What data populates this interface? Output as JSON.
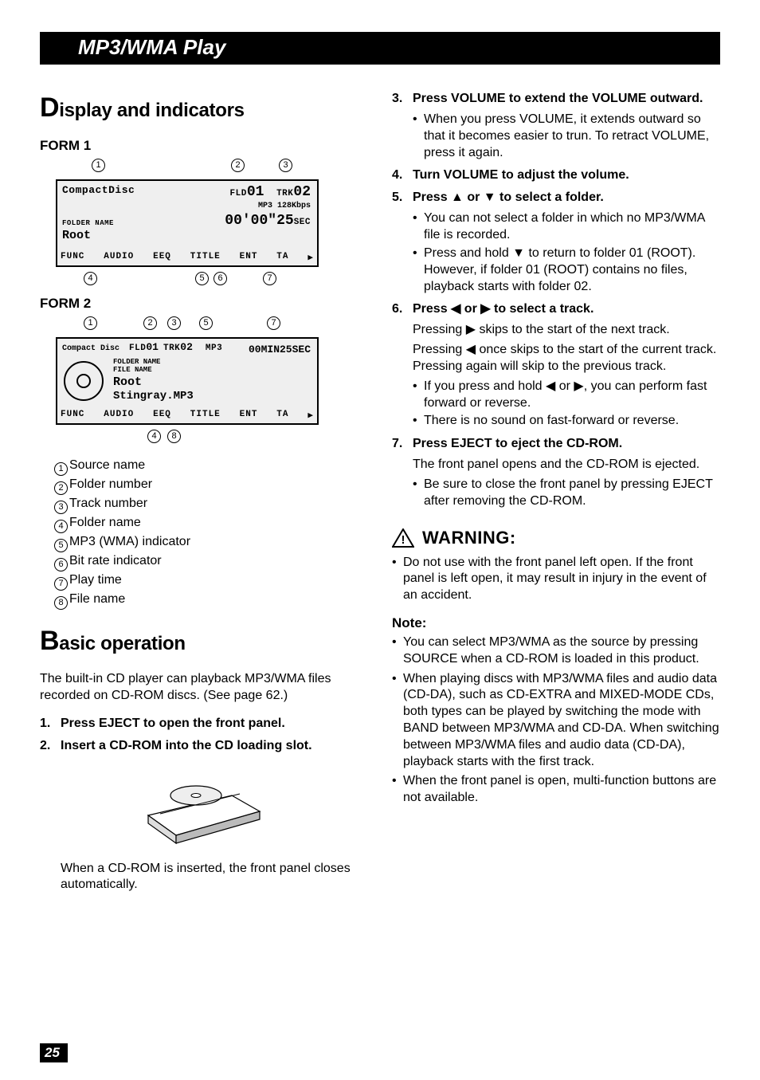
{
  "banner": "MP3/WMA Play",
  "headings": {
    "display": "isplay and indicators",
    "display_cap": "D",
    "basic": "asic operation",
    "basic_cap": "B"
  },
  "forms": {
    "form1": "FORM 1",
    "form2": "FORM 2"
  },
  "display1": {
    "title": "CompactDisc",
    "fld_label": "FLD",
    "fld_val": "01",
    "trk_label": "TRK",
    "trk_val": "02",
    "mp3": "MP3",
    "bitrate": "128Kbps",
    "time": "00'00\"25",
    "sec": "SEC",
    "folder_label": "FOLDER NAME",
    "folder": "Root",
    "bottom": [
      "FUNC",
      "AUDIO",
      "EEQ",
      "TITLE",
      "ENT",
      "TA",
      "▶"
    ]
  },
  "display2": {
    "title": "Compact Disc",
    "fld_label": "FLD",
    "fld_val": "01",
    "trk_label": "TRK",
    "trk_val": "02",
    "mp3": "MP3",
    "time": "00MIN25SEC",
    "folder_label": "FOLDER NAME",
    "file_label": "FILE NAME",
    "folder": "Root",
    "file": "Stingray.MP3",
    "bottom": [
      "FUNC",
      "AUDIO",
      "EEQ",
      "TITLE",
      "ENT",
      "TA",
      "▶"
    ]
  },
  "callouts": {
    "form1_top": [
      "①",
      "②",
      "③"
    ],
    "form1_bottom": [
      "④",
      "⑤",
      "⑥",
      "⑦"
    ],
    "form2_top": [
      "①",
      "②",
      "③",
      "⑤",
      "⑦"
    ],
    "form2_bottom": [
      "④",
      "⑧"
    ]
  },
  "legend": [
    {
      "n": "①",
      "t": "Source name"
    },
    {
      "n": "②",
      "t": "Folder number"
    },
    {
      "n": "③",
      "t": "Track number"
    },
    {
      "n": "④",
      "t": "Folder name"
    },
    {
      "n": "⑤",
      "t": "MP3 (WMA) indicator"
    },
    {
      "n": "⑥",
      "t": "Bit rate indicator"
    },
    {
      "n": "⑦",
      "t": "Play time"
    },
    {
      "n": "⑧",
      "t": "File name"
    }
  ],
  "intro": "The built-in CD player can playback MP3/WMA files recorded on CD-ROM discs. (See page 62.)",
  "steps_left": [
    {
      "n": "1.",
      "t": "Press EJECT to open the front panel."
    },
    {
      "n": "2.",
      "t": "Insert a CD-ROM into the CD loading slot."
    }
  ],
  "left_after_device": "When a CD-ROM is inserted, the front panel closes automatically.",
  "steps_right": [
    {
      "n": "3.",
      "t": "Press VOLUME to extend the VOLUME outward.",
      "bullets": [
        "When you press VOLUME, it extends outward so that it becomes easier to trun. To retract VOLUME, press it again."
      ],
      "subs": []
    },
    {
      "n": "4.",
      "t": "Turn VOLUME to adjust the volume.",
      "bullets": [],
      "subs": []
    },
    {
      "n": "5.",
      "t": "Press ▲ or ▼ to select a folder.",
      "bullets": [
        "You can not select a folder in which no MP3/WMA file is recorded.",
        "Press and hold ▼ to return to folder 01 (ROOT). However, if folder 01 (ROOT) contains no files, playback starts with folder 02."
      ],
      "subs": []
    },
    {
      "n": "6.",
      "t": "Press ◀ or ▶ to select a track.",
      "subs": [
        "Pressing ▶ skips to the start of the next track.",
        "Pressing ◀ once skips to the start of the current track. Pressing again will skip to the previous track."
      ],
      "bullets": [
        "If you press and hold ◀ or ▶, you can perform fast forward or reverse.",
        "There is no sound on fast-forward or reverse."
      ]
    },
    {
      "n": "7.",
      "t": "Press EJECT to eject the CD-ROM.",
      "subs": [
        "The front panel opens and the CD-ROM is ejected."
      ],
      "bullets": [
        "Be sure to close the front panel by pressing EJECT after removing the CD-ROM."
      ]
    }
  ],
  "warning": {
    "head": "WARNING:",
    "body": "Do not use with the front panel left open. If the front panel is left open, it may result in injury in the event of an accident."
  },
  "note": {
    "head": "Note:",
    "items": [
      "You can select MP3/WMA as the source by pressing SOURCE when a CD-ROM is loaded in this product.",
      "When playing discs with MP3/WMA files and audio data (CD-DA), such as CD-EXTRA and MIXED-MODE CDs, both types can be played by switching the mode with BAND between MP3/WMA and CD-DA. When switching between MP3/WMA files and audio data (CD-DA), playback starts with the first track.",
      "When the front panel is open, multi-function buttons are not available."
    ]
  },
  "page_number": "25"
}
